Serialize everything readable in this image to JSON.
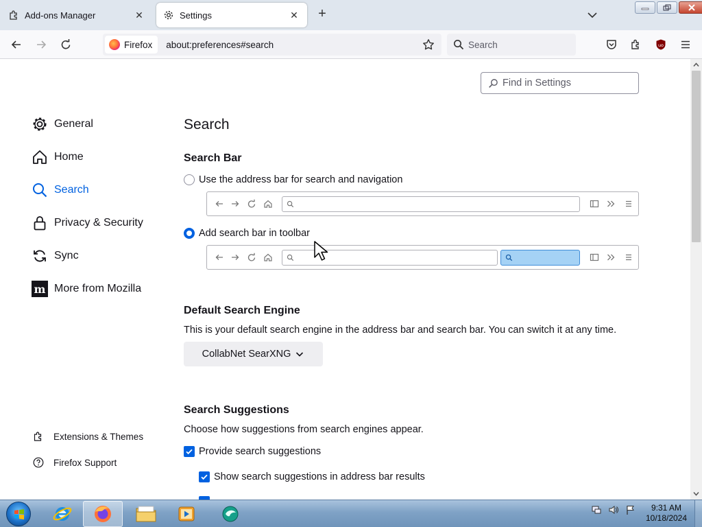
{
  "browser": {
    "tabs": [
      {
        "title": "Add-ons Manager",
        "icon": "puzzle-icon"
      },
      {
        "title": "Settings",
        "icon": "gear-icon"
      }
    ],
    "identity_label": "Firefox",
    "url": "about:preferences#search",
    "search_placeholder": "Search"
  },
  "settings": {
    "find_placeholder": "Find in Settings",
    "categories": [
      {
        "label": "General",
        "icon": "gear-icon"
      },
      {
        "label": "Home",
        "icon": "home-icon"
      },
      {
        "label": "Search",
        "icon": "search-icon",
        "selected": true
      },
      {
        "label": "Privacy & Security",
        "icon": "lock-icon"
      },
      {
        "label": "Sync",
        "icon": "sync-icon"
      },
      {
        "label": "More from Mozilla",
        "icon": "mozilla-icon"
      }
    ],
    "footer_links": [
      {
        "label": "Extensions & Themes",
        "icon": "puzzle-icon"
      },
      {
        "label": "Firefox Support",
        "icon": "help-icon"
      }
    ],
    "page_title": "Search",
    "search_bar": {
      "heading": "Search Bar",
      "option_address_bar": "Use the address bar for search and navigation",
      "option_toolbar": "Add search bar in toolbar",
      "selected": "toolbar"
    },
    "default_engine": {
      "heading": "Default Search Engine",
      "description": "This is your default search engine in the address bar and search bar. You can switch it at any time.",
      "selected": "CollabNet SearXNG"
    },
    "suggestions": {
      "heading": "Search Suggestions",
      "description": "Choose how suggestions from search engines appear.",
      "provide": "Provide search suggestions",
      "show_in_address_bar": "Show search suggestions in address bar results"
    }
  },
  "taskbar": {
    "time": "9:31 AM",
    "date": "10/18/2024"
  },
  "colors": {
    "accent": "#0061e0",
    "tabstrip": "#dfe6ee"
  }
}
